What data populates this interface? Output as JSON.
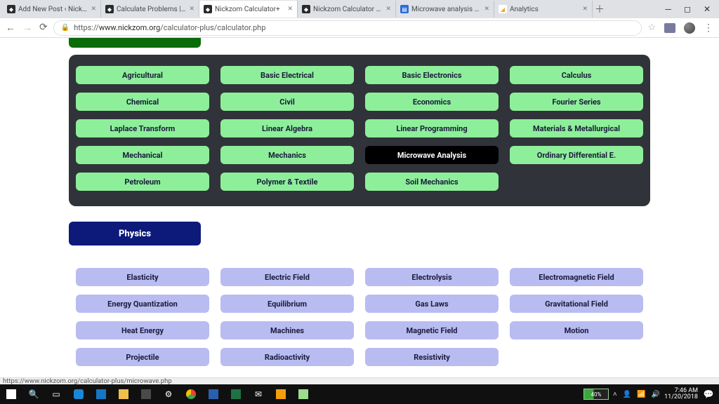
{
  "tabs": [
    {
      "label": "Add New Post ‹ Nickzo",
      "favClass": "fav"
    },
    {
      "label": "Calculate Problems | M",
      "favClass": "fav"
    },
    {
      "label": "Nickzom Calculator+",
      "favClass": "fav",
      "active": true
    },
    {
      "label": "Nickzom Calculator Sol",
      "favClass": "fav"
    },
    {
      "label": "Microwave analysis and",
      "favClass": "fav bars"
    },
    {
      "label": "Analytics",
      "favClass": "fav ga"
    }
  ],
  "window": {
    "newtab": "＋",
    "min": "─",
    "max": "◻",
    "close": "✕"
  },
  "addressbar": {
    "back": "←",
    "fwd": "→",
    "reload": "⟳",
    "lock": "🔒",
    "url_prefix": "https://",
    "url_host": "www.nickzom.org",
    "url_path": "/calculator-plus/calculator.php",
    "star": "☆",
    "dots": "⋮"
  },
  "engineering": {
    "items": [
      {
        "label": "Agricultural"
      },
      {
        "label": "Basic Electrical"
      },
      {
        "label": "Basic Electronics"
      },
      {
        "label": "Calculus"
      },
      {
        "label": "Chemical"
      },
      {
        "label": "Civil"
      },
      {
        "label": "Economics"
      },
      {
        "label": "Fourier Series"
      },
      {
        "label": "Laplace Transform"
      },
      {
        "label": "Linear Algebra"
      },
      {
        "label": "Linear Programming"
      },
      {
        "label": "Materials & Metallurgical"
      },
      {
        "label": "Mechanical"
      },
      {
        "label": "Mechanics"
      },
      {
        "label": "Microwave Analysis",
        "selected": true
      },
      {
        "label": "Ordinary Differential E."
      },
      {
        "label": "Petroleum"
      },
      {
        "label": "Polymer & Textile"
      },
      {
        "label": "Soil Mechanics"
      }
    ]
  },
  "physics": {
    "heading": "Physics",
    "items": [
      {
        "label": "Elasticity"
      },
      {
        "label": "Electric Field"
      },
      {
        "label": "Electrolysis"
      },
      {
        "label": "Electromagnetic Field"
      },
      {
        "label": "Energy Quantization"
      },
      {
        "label": "Equilibrium"
      },
      {
        "label": "Gas Laws"
      },
      {
        "label": "Gravitational Field"
      },
      {
        "label": "Heat Energy"
      },
      {
        "label": "Machines"
      },
      {
        "label": "Magnetic Field"
      },
      {
        "label": "Motion"
      },
      {
        "label": "Projectile"
      },
      {
        "label": "Radioactivity"
      },
      {
        "label": "Resistivity"
      }
    ]
  },
  "status_link": "https://www.nickzom.org/calculator-plus/microwave.php",
  "taskbar": {
    "battery": "40%",
    "time": "7:46 AM",
    "date": "11/20/2018"
  }
}
